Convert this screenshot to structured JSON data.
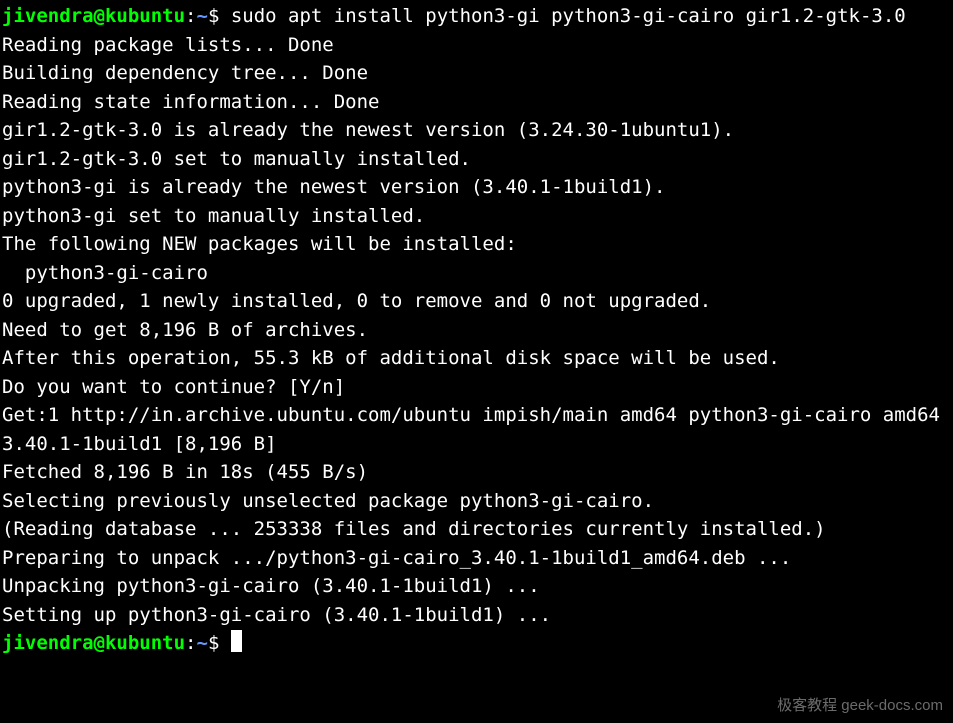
{
  "prompt": {
    "user_host": "jivendra@kubuntu",
    "colon": ":",
    "path": "~",
    "end": "$ "
  },
  "command": "sudo apt install python3-gi python3-gi-cairo gir1.2-gtk-3.0",
  "output_lines": [
    "Reading package lists... Done",
    "Building dependency tree... Done",
    "Reading state information... Done",
    "gir1.2-gtk-3.0 is already the newest version (3.24.30-1ubuntu1).",
    "gir1.2-gtk-3.0 set to manually installed.",
    "python3-gi is already the newest version (3.40.1-1build1).",
    "python3-gi set to manually installed.",
    "The following NEW packages will be installed:",
    "  python3-gi-cairo",
    "0 upgraded, 1 newly installed, 0 to remove and 0 not upgraded.",
    "Need to get 8,196 B of archives.",
    "After this operation, 55.3 kB of additional disk space will be used.",
    "Do you want to continue? [Y/n]",
    "Get:1 http://in.archive.ubuntu.com/ubuntu impish/main amd64 python3-gi-cairo amd64 3.40.1-1build1 [8,196 B]",
    "Fetched 8,196 B in 18s (455 B/s)",
    "Selecting previously unselected package python3-gi-cairo.",
    "(Reading database ... 253338 files and directories currently installed.)",
    "Preparing to unpack .../python3-gi-cairo_3.40.1-1build1_amd64.deb ...",
    "Unpacking python3-gi-cairo (3.40.1-1build1) ...",
    "Setting up python3-gi-cairo (3.40.1-1build1) ..."
  ],
  "watermark": {
    "cn": "极客教程",
    "en": " geek-docs.com"
  }
}
